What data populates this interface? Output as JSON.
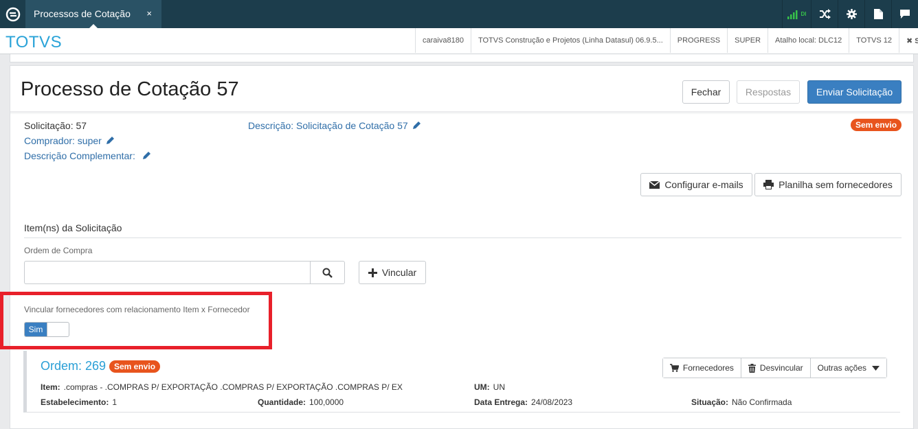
{
  "topbar": {
    "tab_label": "Processos de Cotação",
    "tab_close": "×",
    "signal_text": "DI"
  },
  "infobar": {
    "brand": "TOTVS",
    "items": [
      "caraiva8180",
      "TOTVS Construção e Projetos (Linha Datasul) 06.9.5...",
      "PROGRESS",
      "SUPER",
      "Atalho local: DLC12",
      "TOTVS 12",
      "✖ S"
    ]
  },
  "header": {
    "title": "Processo de Cotação 57",
    "close_label": "Fechar",
    "responses_label": "Respostas",
    "send_label": "Enviar Solicitação"
  },
  "details": {
    "solicitacao": "Solicitação: 57",
    "descricao": "Descrição: Solicitação de Cotação 57",
    "comprador": "Comprador: super",
    "descricao_complementar": "Descrição Complementar:",
    "status_badge": "Sem envio",
    "config_emails_label": "Configurar e-mails",
    "planilha_label": "Planilha sem fornecedores"
  },
  "items_section": {
    "title": "Item(ns) da Solicitação",
    "ordem_label": "Ordem de Compra",
    "ordem_value": "",
    "vincular_label": "Vincular",
    "switch_caption": "Vincular fornecedores com relacionamento Item x Fornecedor",
    "switch_value": "Sim"
  },
  "order": {
    "title": "Ordem: 269",
    "badge": "Sem envio",
    "actions": {
      "fornecedores": "Fornecedores",
      "desvincular": "Desvincular",
      "outras": "Outras ações"
    },
    "fields": {
      "item_label": "Item:",
      "item_value": ".compras - .COMPRAS P/ EXPORTAÇÃO .COMPRAS P/ EXPORTAÇÃO .COMPRAS P/ EX",
      "um_label": "UM:",
      "um_value": "UN",
      "estab_label": "Estabelecimento:",
      "estab_value": "1",
      "qtd_label": "Quantidade:",
      "qtd_value": "100,0000",
      "data_label": "Data Entrega:",
      "data_value": "24/08/2023",
      "situacao_label": "Situação:",
      "situacao_value": "Não Confirmada"
    }
  },
  "colors": {
    "accent": "#3a7fc1",
    "brand": "#2aa3d8",
    "badge": "#e8541d",
    "highlight": "#e8202a",
    "topbar": "#1c3d4c"
  }
}
